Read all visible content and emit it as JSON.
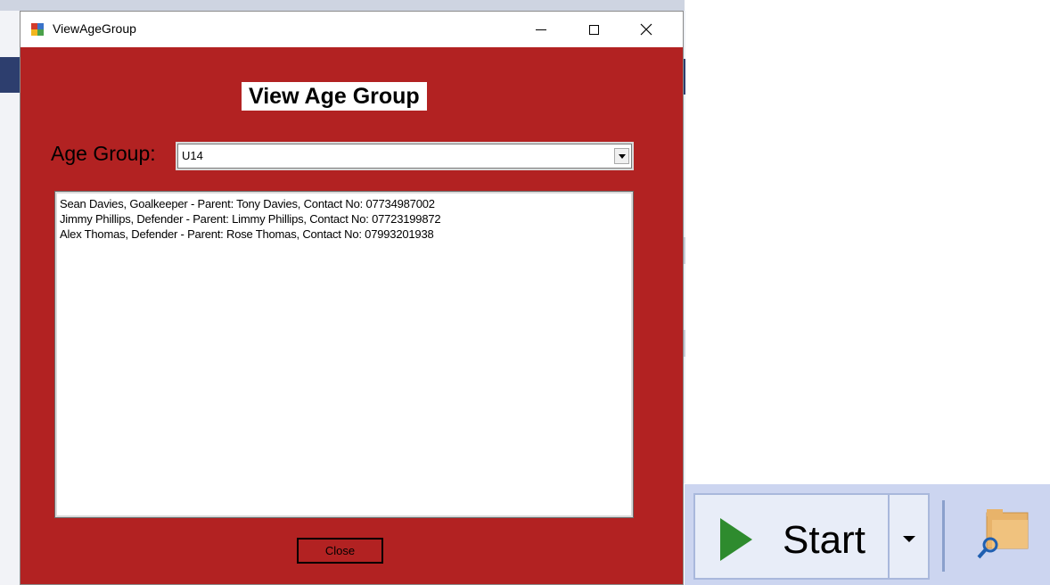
{
  "window": {
    "title": "ViewAgeGroup",
    "controls": {
      "minimize": "minimize",
      "maximize": "maximize",
      "close": "close"
    }
  },
  "form": {
    "heading": "View Age Group",
    "age_group_label": "Age Group:",
    "age_group_selected": "U14",
    "players": [
      "Sean Davies, Goalkeeper - Parent: Tony Davies, Contact No: 07734987002",
      "Jimmy Phillips, Defender - Parent: Limmy Phillips, Contact No: 07723199872",
      "Alex Thomas, Defender - Parent: Rose Thomas, Contact No: 07993201938"
    ],
    "close_label": "Close"
  },
  "toolbar": {
    "start_label": "Start"
  },
  "colors": {
    "form_background": "#b22222",
    "toolbar_background": "#ccd5f0",
    "play_green": "#2e8b2e"
  },
  "icons": [
    "app-icon",
    "play-icon",
    "dropdown-arrow-icon",
    "find-folder-icon"
  ]
}
